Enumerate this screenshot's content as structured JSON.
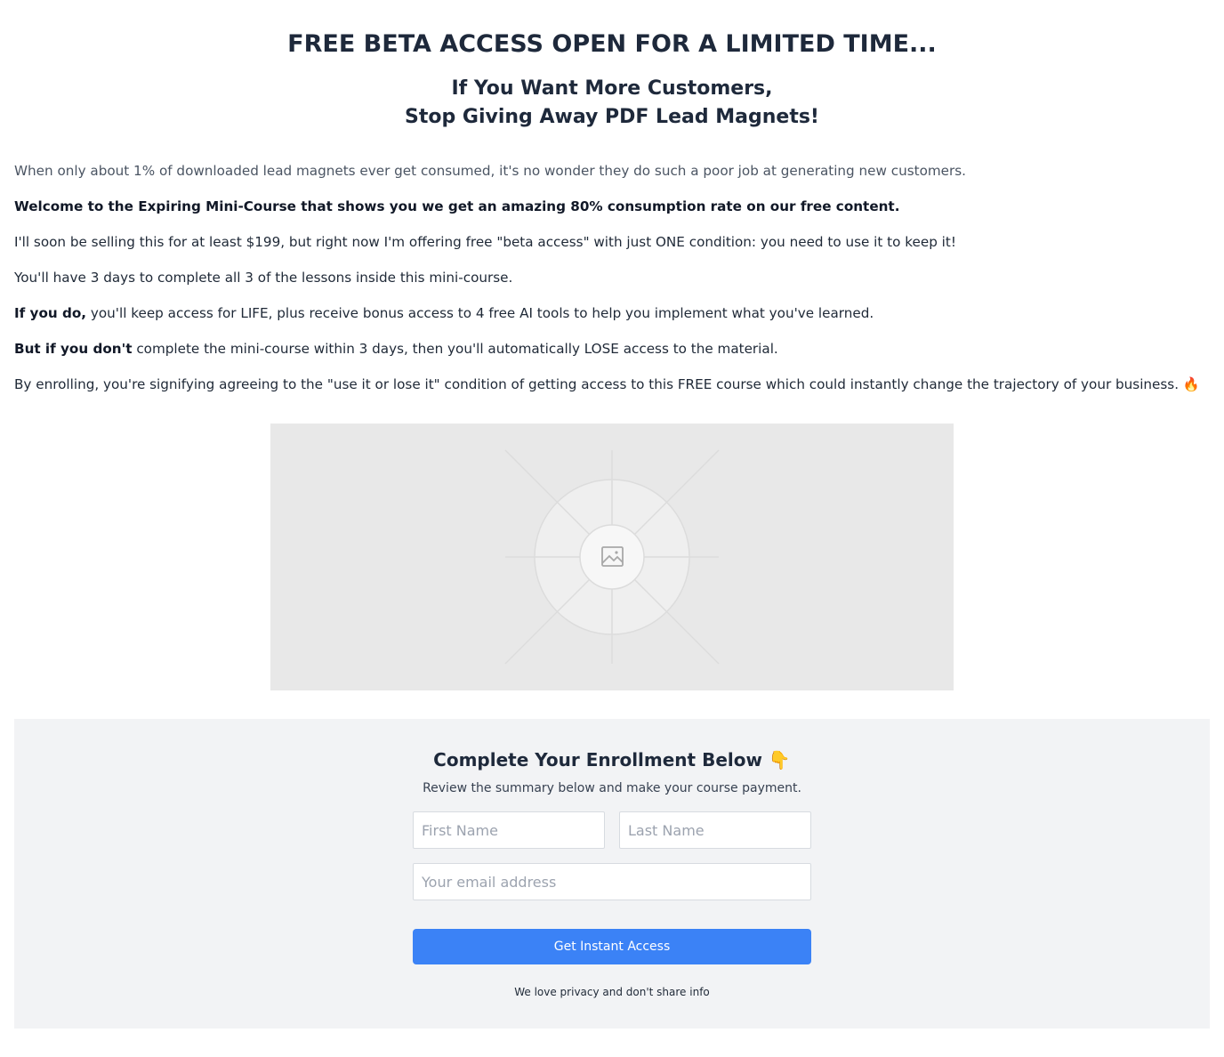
{
  "hero": {
    "headline": "FREE BETA ACCESS OPEN FOR A LIMITED TIME...",
    "subhead_line1": "If You Want More Customers,",
    "subhead_line2": "Stop Giving Away PDF Lead Magnets!"
  },
  "body": {
    "p1": "When only about 1% of downloaded lead magnets ever get consumed, it's no wonder they do such a poor job at generating new customers.",
    "p2": "Welcome to the Expiring Mini-Course that shows you we get an amazing 80% consumption rate on our free content.",
    "p3": "I'll soon be selling this for at least $199, but right now I'm offering free \"beta access\" with just ONE condition: you need to use it to keep it!",
    "p4": "You'll have 3 days to complete all 3 of the lessons inside this mini-course.",
    "p5_bold": "If you do,",
    "p5_rest": " you'll keep access for LIFE, plus receive bonus access to 4 free AI tools to help you implement what you've learned.",
    "p6_bold": "But if you don't",
    "p6_rest": " complete the mini-course within 3 days, then you'll automatically LOSE access to the material.",
    "p7": "By enrolling, you're signifying agreeing to the \"use it or lose it\" condition of getting access to this FREE course which could instantly change the trajectory of your business. 🔥"
  },
  "image": {
    "icon": "image-placeholder-icon"
  },
  "enroll": {
    "title": "Complete Your Enrollment Below 👇",
    "subtitle": "Review the summary below and make your course payment.",
    "first_name_placeholder": "First Name",
    "last_name_placeholder": "Last Name",
    "email_placeholder": "Your email address",
    "button_label": "Get Instant Access",
    "privacy": "We love privacy and don't share info"
  },
  "colors": {
    "accent": "#3b82f6",
    "section_bg": "#f2f3f5",
    "placeholder_bg": "#e8e8e8"
  }
}
